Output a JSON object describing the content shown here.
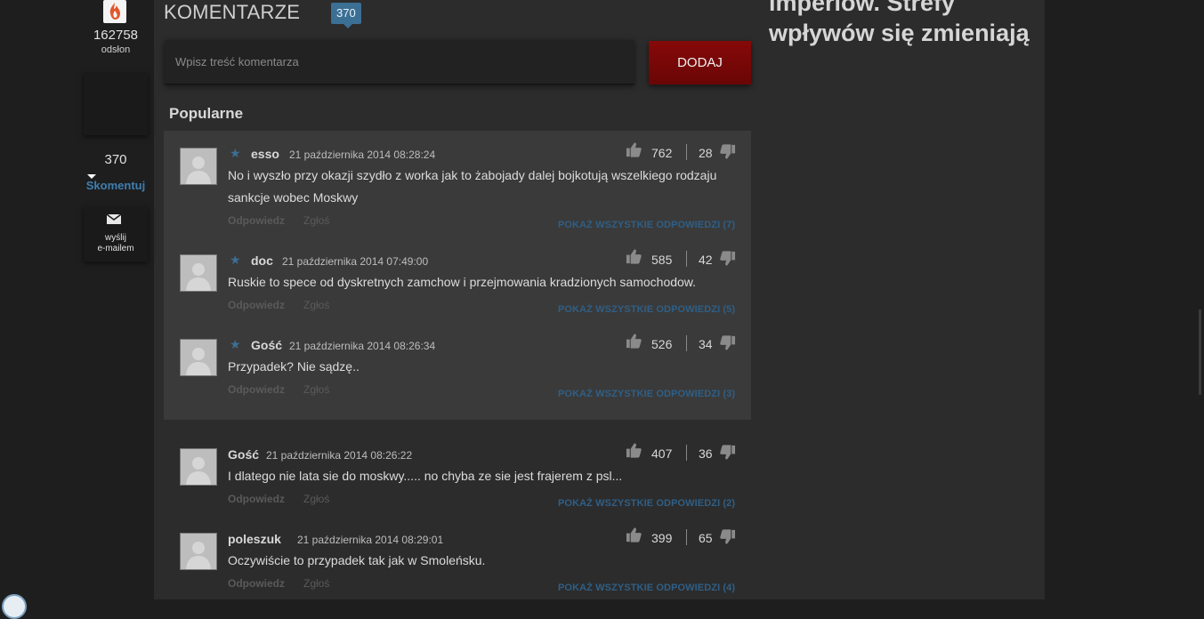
{
  "share": {
    "views_count": "162758",
    "views_label": "odsłon",
    "comments_count": "370",
    "comment_link": "Skomentuj",
    "email_label_line1": "wyślij",
    "email_label_line2": "e-mailem"
  },
  "comments_section": {
    "title": "KOMENTARZE",
    "count_badge": "370",
    "input_placeholder": "Wpisz treść komentarza",
    "add_button": "DODAJ",
    "popular_heading": "Popularne"
  },
  "right_column": {
    "article_title": "imperiów. Strefy wpływów się zmieniają"
  },
  "comments": [
    {
      "starred": true,
      "author": "esso",
      "date": "21 października 2014 08:28:24",
      "text": "No i wyszło przy okazji szydło z worka jak to żabojady dalej bojkotują wszelkiego rodzaju sankcje wobec Moskwy",
      "likes": "762",
      "dislikes": "28",
      "reply": "Odpowiedz",
      "report": "Zgłoś",
      "show_replies": "POKAŻ WSZYSTKIE ODPOWIEDZI (7)"
    },
    {
      "starred": true,
      "author": "doc",
      "date": "21 października 2014 07:49:00",
      "text": "Ruskie to spece od dyskretnych zamchow i przejmowania kradzionych samochodow.",
      "likes": "585",
      "dislikes": "42",
      "reply": "Odpowiedz",
      "report": "Zgłoś",
      "show_replies": "POKAŻ WSZYSTKIE ODPOWIEDZI (5)"
    },
    {
      "starred": true,
      "author": "Gość",
      "date": "21 października 2014 08:26:34",
      "text": "Przypadek? Nie sądzę..",
      "likes": "526",
      "dislikes": "34",
      "reply": "Odpowiedz",
      "report": "Zgłoś",
      "show_replies": "POKAŻ WSZYSTKIE ODPOWIEDZI (3)"
    },
    {
      "starred": false,
      "author": "Gość",
      "date": "21 października 2014 08:26:22",
      "text": "I dlatego nie lata sie do moskwy..... no chyba ze sie jest frajerem z psl...",
      "likes": "407",
      "dislikes": "36",
      "reply": "Odpowiedz",
      "report": "Zgłoś",
      "show_replies": "POKAŻ WSZYSTKIE ODPOWIEDZI (2)"
    },
    {
      "starred": false,
      "author": "poleszuk",
      "date": "21 października 2014 08:29:01",
      "text": "Oczywiście to przypadek tak jak w Smoleńsku.",
      "likes": "399",
      "dislikes": "65",
      "reply": "Odpowiedz",
      "report": "Zgłoś",
      "show_replies": "POKAŻ WSZYSTKIE ODPOWIEDZI (4)"
    }
  ]
}
